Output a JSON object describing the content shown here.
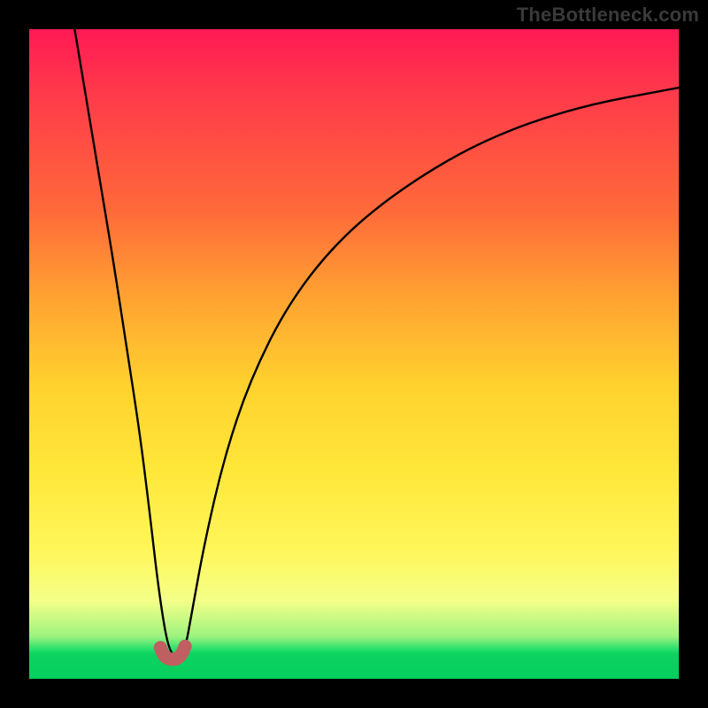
{
  "watermark": "TheBottleneck.com",
  "chart_data": {
    "type": "line",
    "title": "",
    "xlabel": "",
    "ylabel": "",
    "xlim": [
      0,
      100
    ],
    "ylim": [
      0,
      100
    ],
    "series": [
      {
        "name": "bottleneck-curve",
        "x": [
          7,
          9,
          11,
          13,
          15,
          17,
          18.5,
          20,
          21.5,
          23,
          24,
          25,
          27,
          30,
          34,
          40,
          48,
          58,
          70,
          84,
          100
        ],
        "y": [
          100,
          88,
          76,
          64,
          51,
          38,
          26,
          13,
          4,
          3.5,
          4.5,
          10,
          21,
          34,
          46,
          58,
          68,
          76,
          83,
          88,
          91
        ]
      }
    ],
    "markers": [
      {
        "name": "optimal-segment",
        "x": [
          20.2,
          20.8,
          21.7,
          22.6,
          23.4,
          24.0
        ],
        "y": [
          4.8,
          3.4,
          3.0,
          3.0,
          3.6,
          5.0
        ]
      }
    ],
    "colors": {
      "curve": "#000000",
      "marker": "#c06060",
      "gradient_top": "#ff1a55",
      "gradient_mid": "#ffe73a",
      "gradient_bottom": "#05cf5d"
    }
  }
}
